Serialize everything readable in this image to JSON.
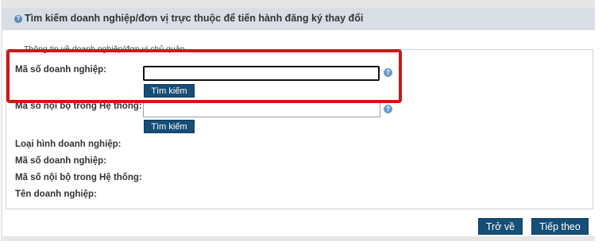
{
  "header": {
    "title": "Tìm kiếm doanh nghiệp/đơn vị trực thuộc để tiến hành đăng ký thay đổi",
    "icon": "help-circle-icon"
  },
  "form": {
    "legend": "Thông tin về doanh nghiệp/đơn vị chủ quản",
    "enterprise_code_label": "Mã số doanh nghiệp:",
    "enterprise_code_value": "",
    "internal_code_label": "Mã số nội bộ trong Hệ thống:",
    "internal_code_value": "",
    "search_button_label": "Tìm kiếm",
    "help_icon": "help-circle-icon"
  },
  "results": {
    "type_label": "Loại hình doanh nghiệp:",
    "enterprise_code_label": "Mã số doanh nghiệp:",
    "internal_code_label": "Mã số nội bộ trong Hệ thống:",
    "name_label": "Tên doanh nghiệp:"
  },
  "footer": {
    "back_label": "Trở về",
    "next_label": "Tiếp theo"
  },
  "colors": {
    "button_bg": "#164e76",
    "highlight": "#d01616",
    "header_bg": "#d9dde4"
  }
}
